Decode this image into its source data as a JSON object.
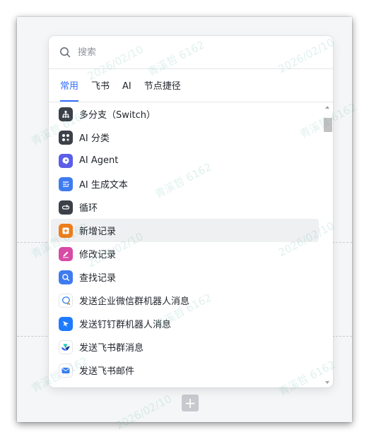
{
  "search": {
    "placeholder": "搜索"
  },
  "tabs": [
    {
      "label": "常用",
      "active": true
    },
    {
      "label": "飞书",
      "active": false
    },
    {
      "label": "AI",
      "active": false
    },
    {
      "label": "节点捷径",
      "active": false
    }
  ],
  "items": [
    {
      "label": "多分支（Switch）",
      "icon": "branch-icon",
      "color": "#3b4049"
    },
    {
      "label": "AI 分类",
      "icon": "ai-classify-icon",
      "color": "#3b4049"
    },
    {
      "label": "AI Agent",
      "icon": "ai-agent-icon",
      "color": "#5b5ee8"
    },
    {
      "label": "AI 生成文本",
      "icon": "text-generate-icon",
      "color": "#3f7bf0"
    },
    {
      "label": "循环",
      "icon": "loop-icon",
      "color": "#3b4049"
    },
    {
      "label": "新增记录",
      "icon": "add-record-icon",
      "color": "#ef7d1a",
      "hover": true
    },
    {
      "label": "修改记录",
      "icon": "edit-record-icon",
      "color": "#d84ba6"
    },
    {
      "label": "查找记录",
      "icon": "search-record-icon",
      "color": "#3f7bf0"
    },
    {
      "label": "发送企业微信群机器人消息",
      "icon": "wecom-icon",
      "color": "#ffffff"
    },
    {
      "label": "发送钉钉群机器人消息",
      "icon": "dingtalk-icon",
      "color": "#1e7bff"
    },
    {
      "label": "发送飞书群消息",
      "icon": "feishu-icon",
      "color": "#ffffff"
    },
    {
      "label": "发送飞书邮件",
      "icon": "mail-icon",
      "color": "#ffffff"
    }
  ],
  "watermark": {
    "text": "青溪哲 6162",
    "date": "2026/02/10"
  }
}
